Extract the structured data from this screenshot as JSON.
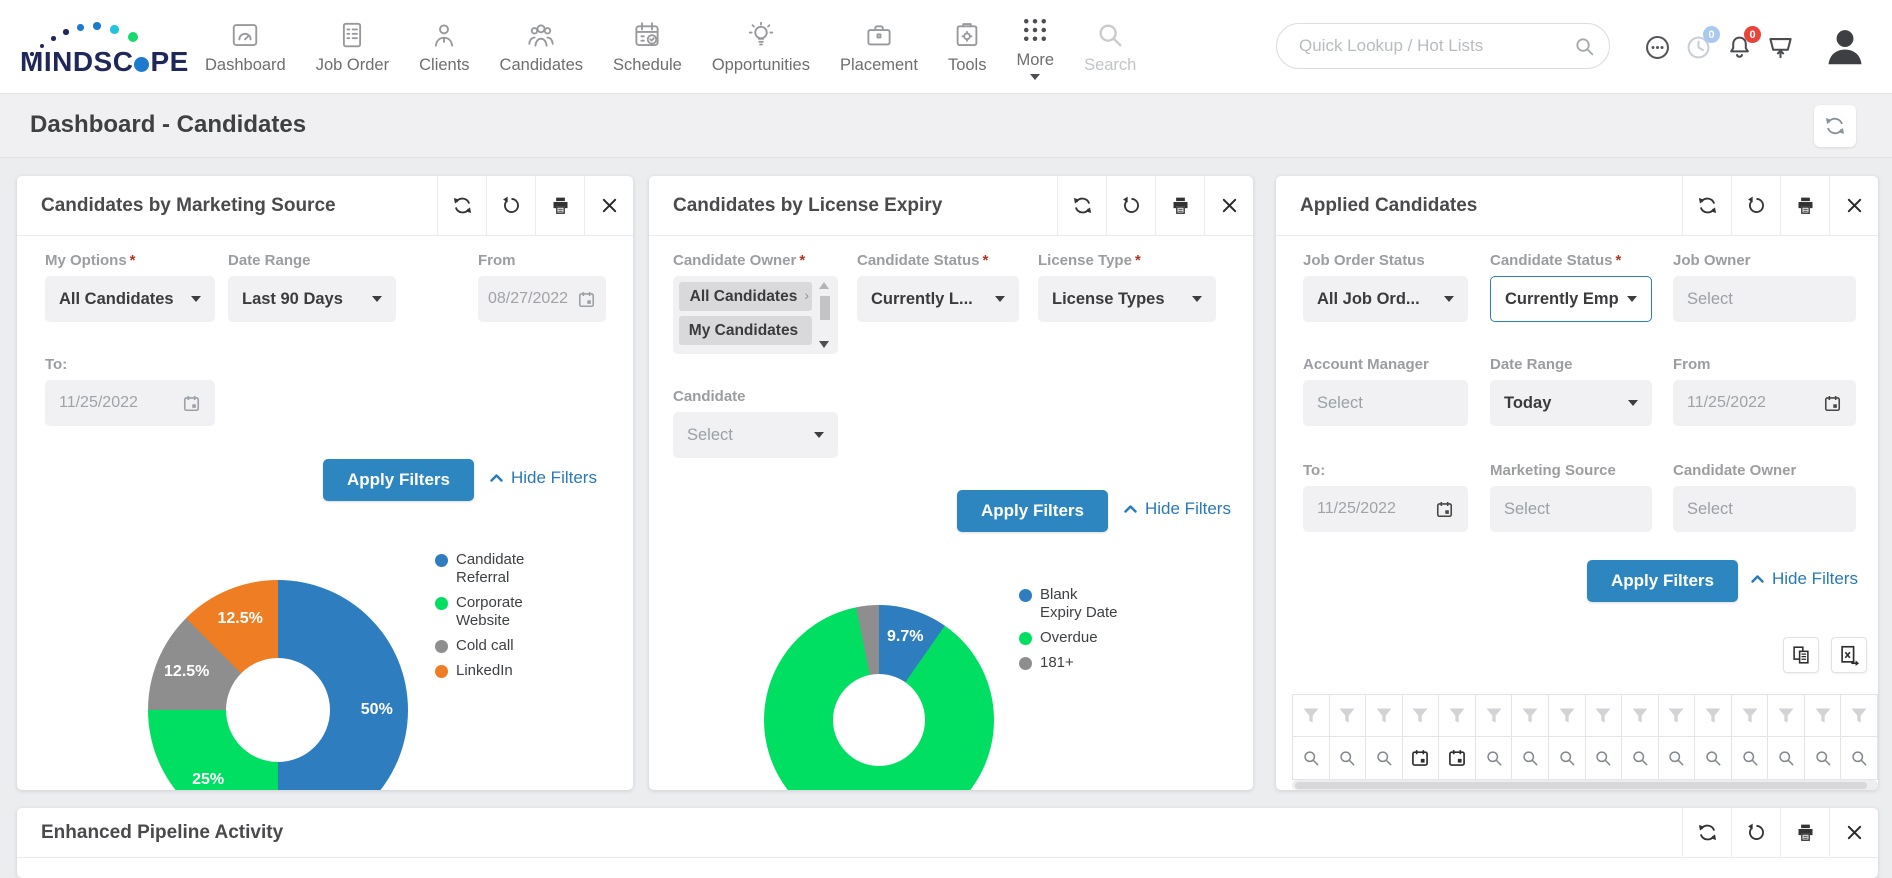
{
  "brand": {
    "text": "MINDSCOPE",
    "part1": "MINDSC",
    "part2": "PE"
  },
  "nav": {
    "items": [
      {
        "label": "Dashboard"
      },
      {
        "label": "Job Order"
      },
      {
        "label": "Clients"
      },
      {
        "label": "Candidates"
      },
      {
        "label": "Schedule"
      },
      {
        "label": "Opportunities"
      },
      {
        "label": "Placement"
      },
      {
        "label": "Tools"
      },
      {
        "label": "More"
      },
      {
        "label": "Search"
      }
    ]
  },
  "topbar": {
    "search_placeholder": "Quick Lookup / Hot Lists",
    "activity_badge": "0",
    "notification_badge": "0"
  },
  "page": {
    "title": "Dashboard - Candidates"
  },
  "panels": {
    "marketing": {
      "title": "Candidates by Marketing Source",
      "filters": {
        "my_options": {
          "label": "My Options",
          "req": "*",
          "value": "All Candidates"
        },
        "date_range": {
          "label": "Date Range",
          "req": "",
          "value": "Last 90 Days"
        },
        "from": {
          "label": "From",
          "value": "08/27/2022"
        },
        "to": {
          "label": "To:",
          "value": "11/25/2022"
        }
      },
      "actions": {
        "apply": "Apply Filters",
        "hide": "Hide Filters"
      },
      "chart_data": {
        "type": "pie",
        "donut": true,
        "categories": [
          "Candidate Referral",
          "Corporate Website",
          "Cold call",
          "LinkedIn"
        ],
        "values": [
          50,
          25,
          12.5,
          12.5
        ],
        "labels": [
          "50%",
          "25%",
          "12.5%",
          "12.5%"
        ],
        "colors": [
          "#2e7dbf",
          "#00df62",
          "#8e8e8e",
          "#ee7d23"
        ],
        "legend_position": "right"
      }
    },
    "license": {
      "title": "Candidates by License Expiry",
      "filters": {
        "candidate_owner": {
          "label": "Candidate Owner",
          "req": "*",
          "selected": "All Candidates",
          "next": "My Candidates"
        },
        "candidate_status": {
          "label": "Candidate Status",
          "req": "*",
          "value": "Currently L..."
        },
        "license_type": {
          "label": "License Type",
          "req": "*",
          "value": "License Types"
        },
        "candidate": {
          "label": "Candidate",
          "placeholder": "Select"
        }
      },
      "actions": {
        "apply": "Apply Filters",
        "hide": "Hide Filters"
      },
      "chart_data": {
        "type": "pie",
        "donut": true,
        "categories": [
          "Blank Expiry Date",
          "Overdue",
          "181+"
        ],
        "values": [
          9.7,
          87.1,
          3.2
        ],
        "labels": [
          "9.7%",
          "",
          ""
        ],
        "colors": [
          "#2e7dbf",
          "#00df62",
          "#8e8e8e"
        ],
        "legend_position": "right"
      }
    },
    "applied": {
      "title": "Applied Candidates",
      "filters": {
        "job_order_status": {
          "label": "Job Order Status",
          "req": "",
          "value": "All Job Ord..."
        },
        "candidate_status": {
          "label": "Candidate Status",
          "req": "*",
          "value": "Currently Emp"
        },
        "job_owner": {
          "label": "Job Owner",
          "placeholder": "Select"
        },
        "account_manager": {
          "label": "Account Manager",
          "placeholder": "Select"
        },
        "date_range": {
          "label": "Date Range",
          "req": "",
          "value": "Today"
        },
        "from": {
          "label": "From",
          "value": "11/25/2022"
        },
        "to": {
          "label": "To:",
          "value": "11/25/2022"
        },
        "marketing_source": {
          "label": "Marketing Source",
          "placeholder": "Select"
        },
        "candidate_owner": {
          "label": "Candidate Owner",
          "placeholder": "Select"
        }
      },
      "actions": {
        "apply": "Apply Filters",
        "hide": "Hide Filters"
      },
      "table": {
        "columns": 16,
        "calendar_columns": [
          3,
          4
        ]
      }
    },
    "pipeline": {
      "title": "Enhanced Pipeline Activity"
    }
  }
}
